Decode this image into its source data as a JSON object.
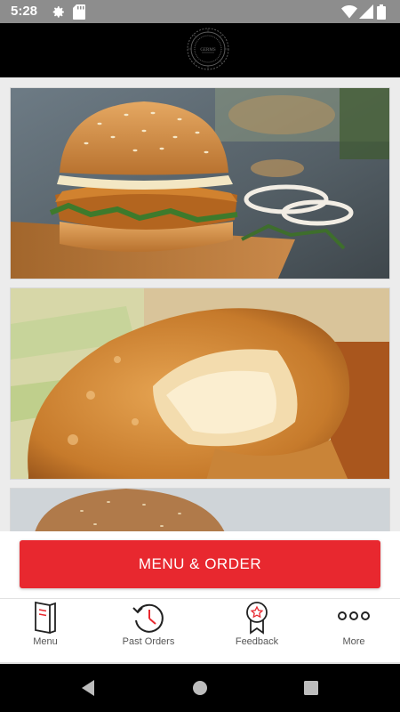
{
  "status_bar": {
    "time": "5:28",
    "icons": [
      "settings-icon",
      "sd-card-icon",
      "wifi-icon",
      "cell-signal-icon",
      "battery-icon"
    ]
  },
  "header": {
    "logo_icon": "restaurant-logo-emblem",
    "logo_text": "GERMS"
  },
  "food_cards": [
    {
      "name": "fried-chicken-burger"
    },
    {
      "name": "cheese-filled-pastry"
    },
    {
      "name": "wholegrain-bun-burger"
    }
  ],
  "order": {
    "button_label": "MENU & ORDER",
    "button_color": "#e8282f"
  },
  "bottom_nav": {
    "items": [
      {
        "label": "Menu",
        "icon": "menu-book-icon"
      },
      {
        "label": "Past Orders",
        "icon": "history-clock-icon"
      },
      {
        "label": "Feedback",
        "icon": "award-ribbon-icon"
      },
      {
        "label": "More",
        "icon": "more-dots-icon"
      }
    ]
  },
  "system_nav": {
    "buttons": [
      "back-icon",
      "home-icon",
      "recents-icon"
    ]
  },
  "colors": {
    "accent": "#e8282f",
    "header_bg": "#000000",
    "status_bar_bg": "#8d8d8d"
  }
}
